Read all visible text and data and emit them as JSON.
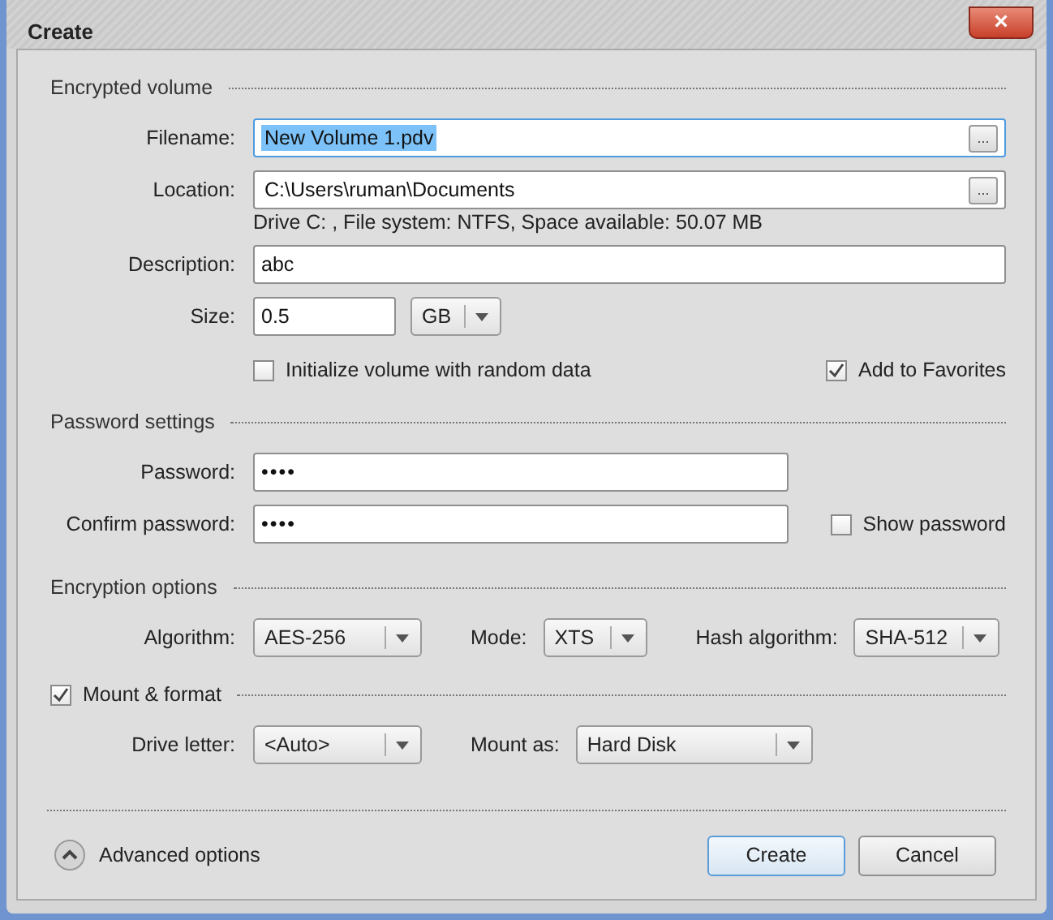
{
  "window": {
    "title": "Create",
    "close_button": "×"
  },
  "encrypted_volume": {
    "heading": "Encrypted volume",
    "filename": {
      "label": "Filename:",
      "value": "New Volume 1.pdv",
      "text_highlighted": true,
      "browse_button": "..."
    },
    "location": {
      "label": "Location:",
      "value": "C:\\Users\\ruman\\Documents",
      "browse_button": "..."
    },
    "drive_info": "Drive C: , File system: NTFS, Space available: 50.07 MB",
    "description": {
      "label": "Description:",
      "value": "abc"
    },
    "size": {
      "label": "Size:",
      "value": "0.5",
      "unit": "GB"
    },
    "checkboxes": [
      {
        "label": "Initialize volume with random data",
        "checked": false
      },
      {
        "label": "Add to Favorites",
        "checked": true
      }
    ]
  },
  "password_settings": {
    "heading": "Password settings",
    "password": {
      "label": "Password:",
      "value": "••••"
    },
    "confirm": {
      "label": "Confirm password:",
      "value": "••••"
    },
    "show_password": {
      "label": "Show password",
      "checked": false
    }
  },
  "encryption_options": {
    "heading": "Encryption options",
    "dropdowns": [
      {
        "label": "Algorithm:",
        "value": "AES-256"
      },
      {
        "label": "Mode:",
        "value": "XTS"
      },
      {
        "label": "Hash algorithm:",
        "value": "SHA-512"
      }
    ]
  },
  "mount_format": {
    "label": "Mount & format",
    "checked": true,
    "dropdowns": [
      {
        "label": "Drive letter:",
        "value": "<Auto>"
      },
      {
        "label": "Mount as:",
        "value": "Hard Disk"
      }
    ]
  },
  "footer": {
    "advanced_options": "Advanced options",
    "buttons": [
      {
        "label": "Create",
        "default": true
      },
      {
        "label": "Cancel",
        "default": false
      }
    ]
  }
}
